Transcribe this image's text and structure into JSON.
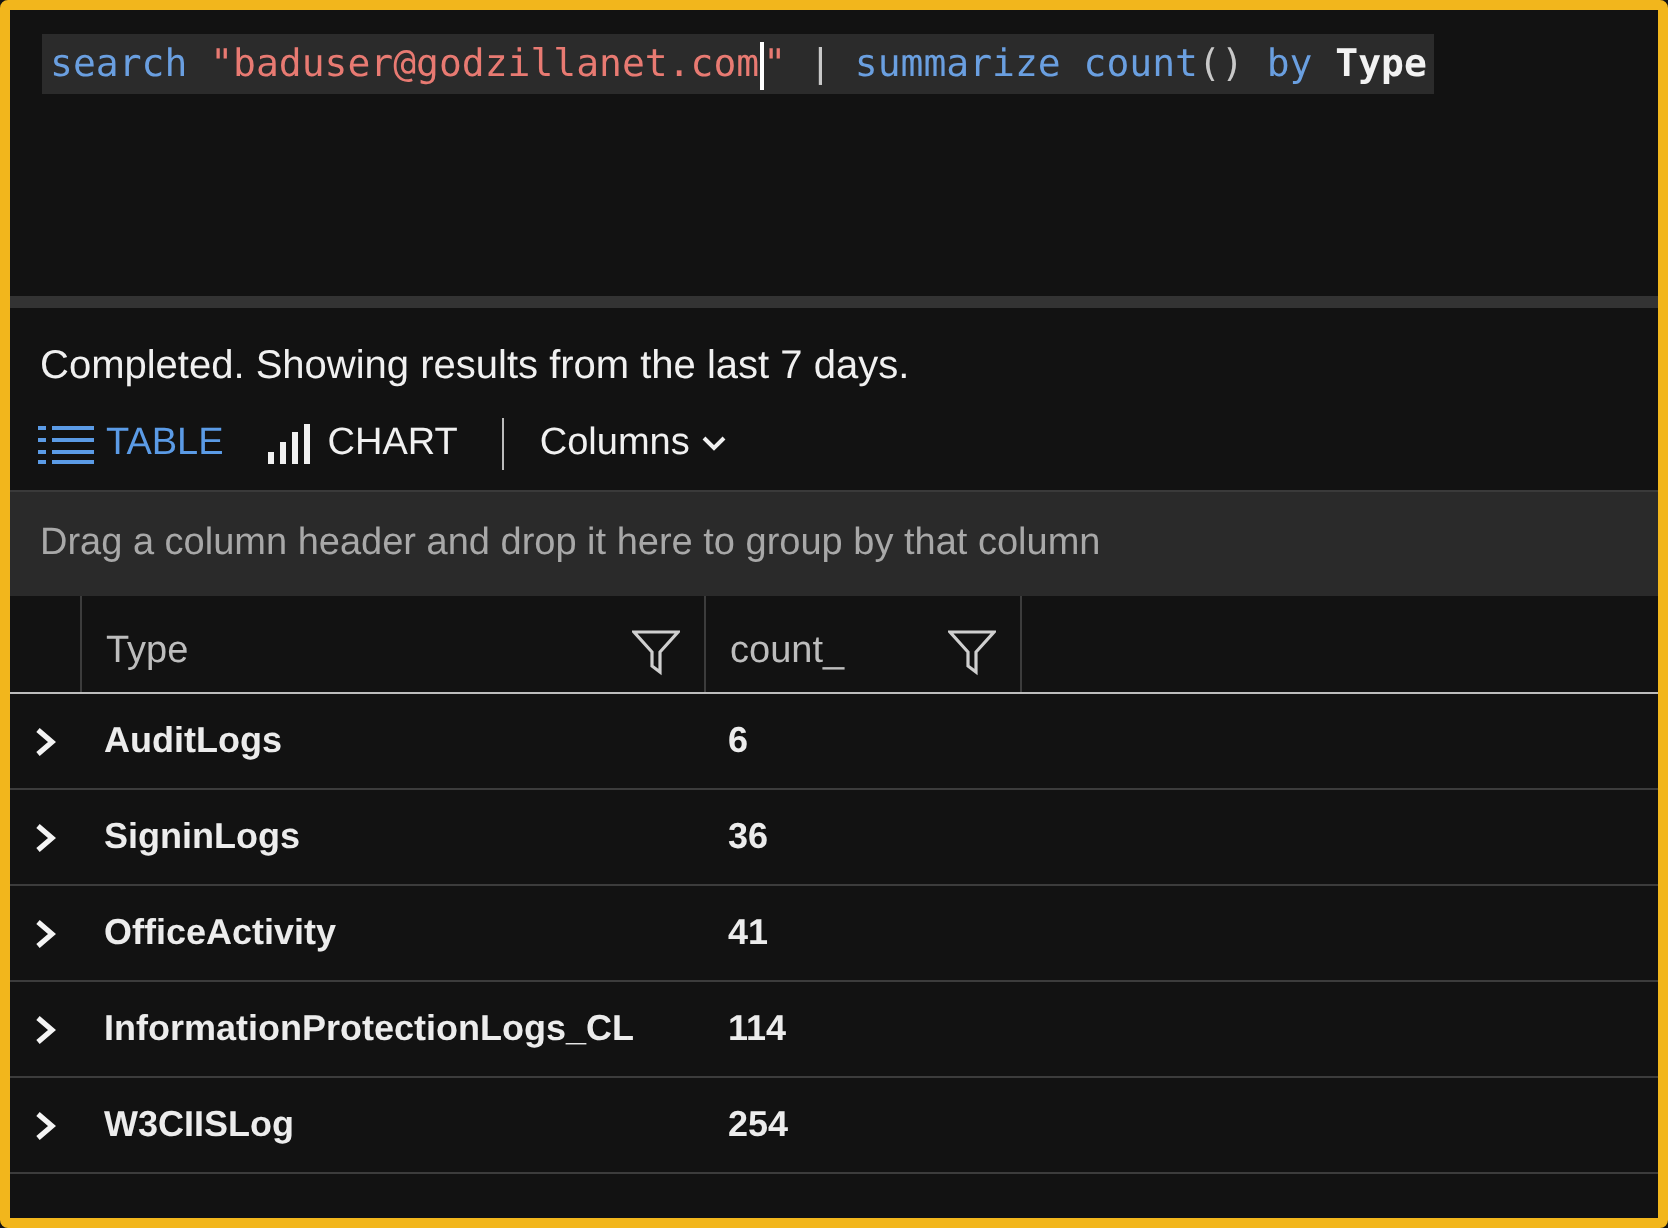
{
  "query": {
    "tokens": [
      {
        "text": "search",
        "kind": "keyword"
      },
      {
        "text": " \"baduser@godzillanet.com",
        "kind": "string"
      },
      {
        "kind": "caret"
      },
      {
        "text": "\"",
        "kind": "string"
      },
      {
        "text": " | ",
        "kind": "plain"
      },
      {
        "text": "summarize",
        "kind": "keyword"
      },
      {
        "text": " count",
        "kind": "keyword"
      },
      {
        "text": "()",
        "kind": "plain"
      },
      {
        "text": " by",
        "kind": "keyword"
      },
      {
        "text": " Type",
        "kind": "identifier"
      }
    ]
  },
  "status": "Completed. Showing results from the last 7 days.",
  "view_tabs": [
    {
      "label": "TABLE",
      "kind": "table",
      "selected": true
    },
    {
      "label": "CHART",
      "kind": "chart",
      "selected": false
    }
  ],
  "columns_button": "Columns",
  "group_by_hint": "Drag a column header and drop it here to group by that column",
  "table": {
    "columns": [
      "Type",
      "count_"
    ],
    "rows": [
      {
        "cells": [
          "AuditLogs",
          "6"
        ],
        "expanded": false
      },
      {
        "cells": [
          "SigninLogs",
          "36"
        ],
        "expanded": false
      },
      {
        "cells": [
          "OfficeActivity",
          "41"
        ],
        "expanded": false
      },
      {
        "cells": [
          "InformationProtectionLogs_CL",
          "114"
        ],
        "expanded": false
      },
      {
        "cells": [
          "W3CIISLog",
          "254"
        ],
        "expanded": false
      }
    ]
  }
}
